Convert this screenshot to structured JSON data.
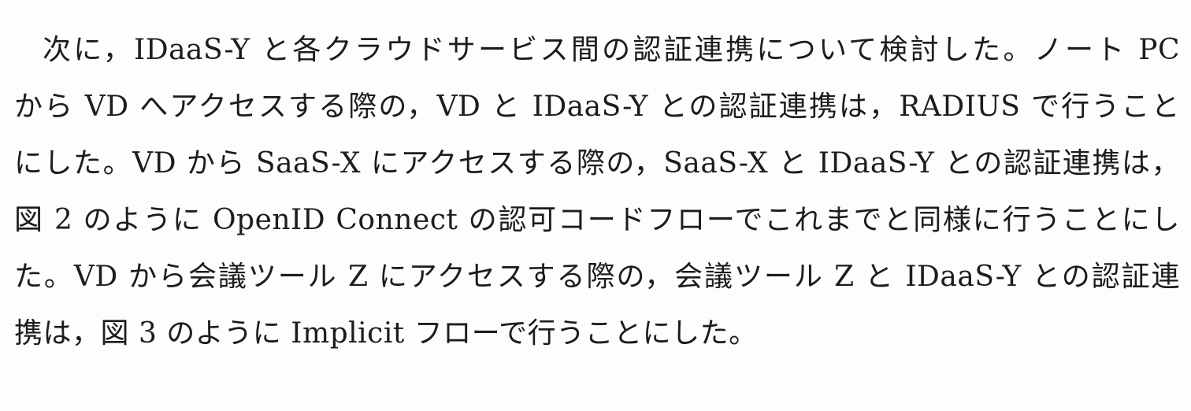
{
  "document": {
    "lines": [
      "次に，IDaaS-Y と各クラウドサービス間の認証連携について検討した。ノート PC",
      "から VD へアクセスする際の，VD と IDaaS-Y との認証連携は，RADIUS で行うこと",
      "にした。VD から SaaS-X にアクセスする際の，SaaS-X と IDaaS-Y との認証連携は，",
      "図 2 のように OpenID Connect の認可コードフローでこれまでと同様に行うことにし",
      "た。VD から会議ツール Z にアクセスする際の，会議ツール Z と IDaaS-Y との認証連",
      "携は，図 3 のように Implicit フローで行うことにした。"
    ]
  }
}
